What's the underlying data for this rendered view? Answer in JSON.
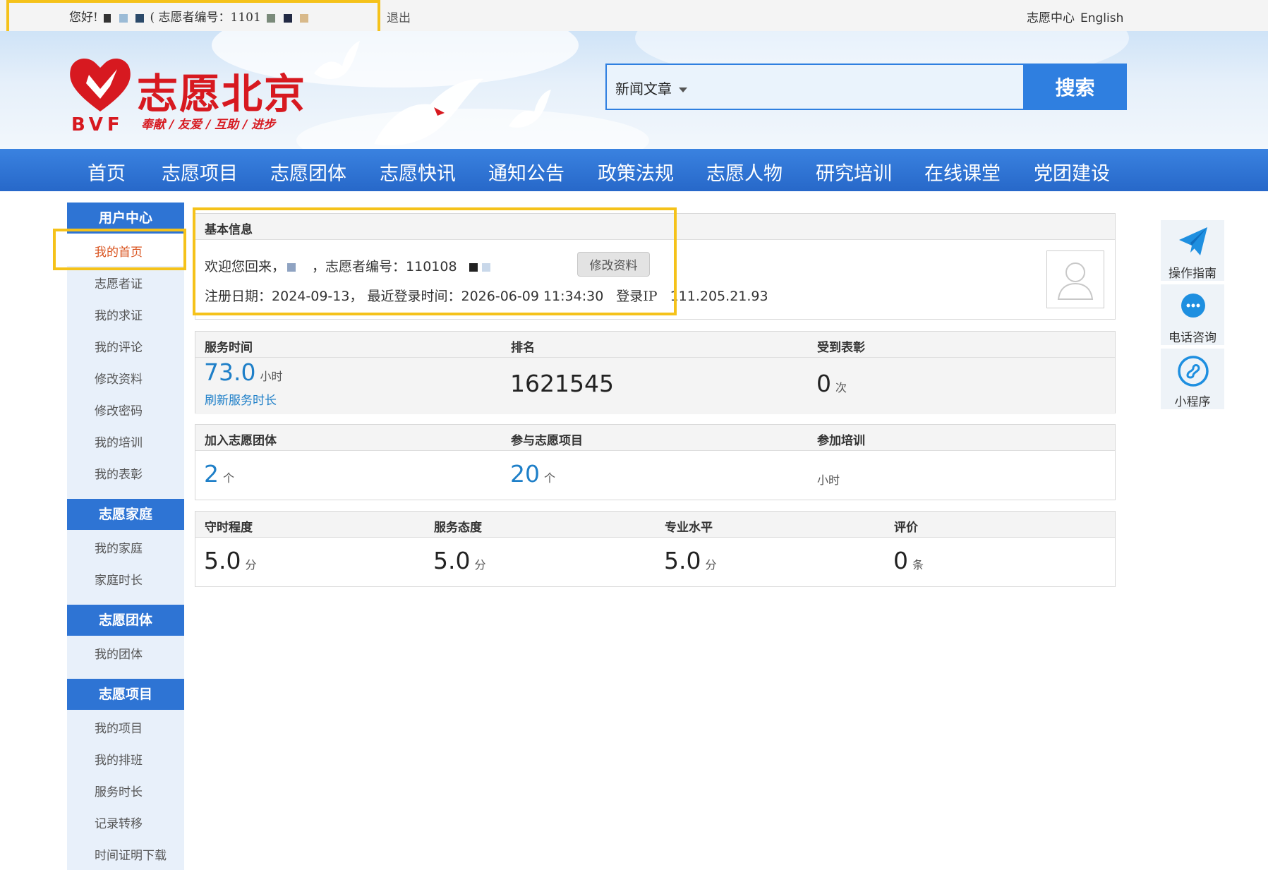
{
  "topbar": {
    "greeting": "您好!",
    "volunteer_id_prefix": "( 志愿者编号：1101",
    "logout": "退出",
    "center": "志愿中心",
    "english": "English"
  },
  "header": {
    "logo_text": "志愿北京",
    "logo_abbr": "BVF",
    "slogan": "奉献 / 友爱 / 互助 / 进步",
    "search_category": "新闻文章",
    "search_button": "搜索",
    "accent_red": "#d71920",
    "accent_blue": "#2e74d4"
  },
  "nav": [
    "首页",
    "志愿项目",
    "志愿团体",
    "志愿快讯",
    "通知公告",
    "政策法规",
    "志愿人物",
    "研究培训",
    "在线课堂",
    "党团建设"
  ],
  "sidebar": {
    "sections": [
      {
        "title": "用户中心",
        "items": [
          "我的首页",
          "志愿者证",
          "我的求证",
          "我的评论",
          "修改资料",
          "修改密码",
          "我的培训",
          "我的表彰"
        ]
      },
      {
        "title": "志愿家庭",
        "items": [
          "我的家庭",
          "家庭时长"
        ]
      },
      {
        "title": "志愿团体",
        "items": [
          "我的团体"
        ]
      },
      {
        "title": "志愿项目",
        "items": [
          "我的项目",
          "我的排班",
          "服务时长",
          "记录转移",
          "时间证明下载"
        ]
      }
    ]
  },
  "basic_info": {
    "title": "基本信息",
    "welcome": "欢迎您回来，",
    "id_label": "，志愿者编号：",
    "id_value": "110108",
    "edit_button": "修改资料",
    "reg_label": "注册日期：",
    "reg_date": "2024-09-13",
    "last_login_label": "， 最近登录时间：",
    "last_login": "2026-06-09 11:34:30",
    "ip_label": "登录IP",
    "ip": "111.205.21.93"
  },
  "stats1": {
    "service_time_label": "服务时间",
    "service_time_value": "73.0",
    "service_time_unit": "小时",
    "refresh_link": "刷新服务时长",
    "rank_label": "排名",
    "rank_value": "1621545",
    "honor_label": "受到表彰",
    "honor_value": "0",
    "honor_unit": "次"
  },
  "stats2": {
    "groups_label": "加入志愿团体",
    "groups_value": "2",
    "groups_unit": "个",
    "projects_label": "参与志愿项目",
    "projects_value": "20",
    "projects_unit": "个",
    "training_label": "参加培训",
    "training_unit": "小时"
  },
  "stats3": {
    "punctual_label": "守时程度",
    "punctual_value": "5.0",
    "attitude_label": "服务态度",
    "attitude_value": "5.0",
    "skill_label": "专业水平",
    "skill_value": "5.0",
    "score_unit": "分",
    "review_label": "评价",
    "review_value": "0",
    "review_unit": "条"
  },
  "float_tools": [
    "操作指南",
    "电话咨询",
    "小程序"
  ]
}
